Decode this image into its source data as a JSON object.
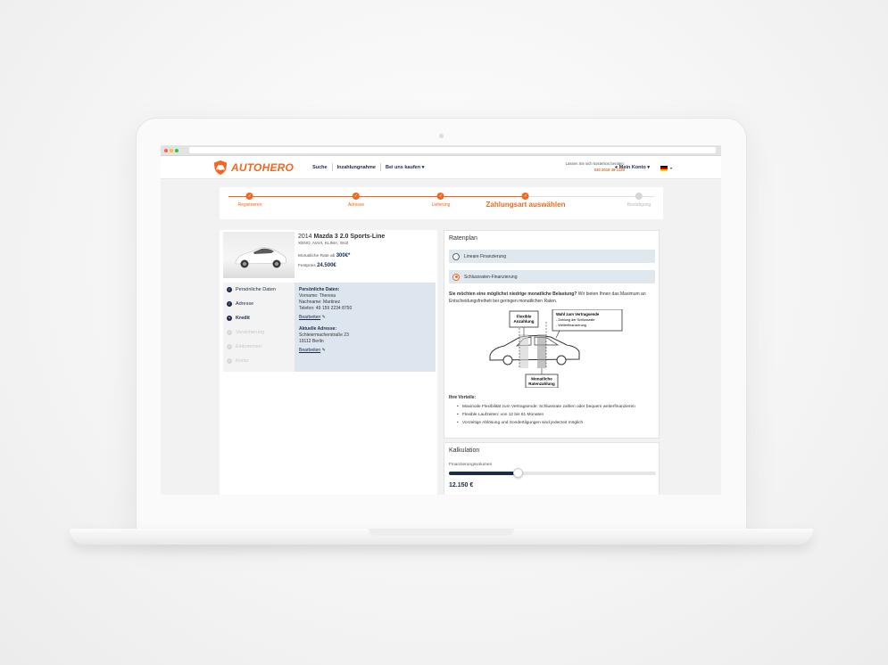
{
  "brand": {
    "name": "AUTOHERO",
    "accent": "#f26722",
    "navy": "#1a2b4c"
  },
  "nav": {
    "items": [
      "Suche",
      "Inzahlungnahme",
      "Bei uns kaufen ▾"
    ]
  },
  "advice": {
    "text": "Lassen Sie sich kostenlos beraten:",
    "phone": "030 2016 38 1120"
  },
  "account": {
    "label": "Mein Konto ▾"
  },
  "progress": {
    "steps": [
      {
        "label": "Registrieren",
        "state": "done"
      },
      {
        "label": "Adresse",
        "state": "done"
      },
      {
        "label": "Lieferung",
        "state": "done"
      },
      {
        "label": "Zahlungsart auswählen",
        "state": "active"
      },
      {
        "label": "Bestätigung",
        "state": "todo"
      }
    ],
    "check": "✓"
  },
  "car": {
    "year": "2014",
    "model": "Mazda 3 2.0 Sports-Line",
    "features": "XENO, NAVI, KLIMA, SHZ",
    "rate_label": "Monatliche Rate ab",
    "rate_value": "300€*",
    "price_label": "Festpreis",
    "price_value": "24.500€"
  },
  "sidenav": {
    "items": [
      {
        "label": "Persönliche Daten",
        "state": "done",
        "icon": "✓"
      },
      {
        "label": "Adresse",
        "state": "done",
        "icon": "✓"
      },
      {
        "label": "Kredit",
        "state": "current",
        "icon": "+"
      },
      {
        "label": "Versicherung",
        "state": "disabled",
        "icon": "+"
      },
      {
        "label": "Einkommen",
        "state": "disabled",
        "icon": "+"
      },
      {
        "label": "Konto",
        "state": "disabled",
        "icon": "+"
      }
    ]
  },
  "personal": {
    "heading": "Persönliche Daten:",
    "first": "Vorname: Theresa",
    "last": "Nachname: Martinez",
    "phone": "Telefon: 49 159 2234 8750",
    "edit": "Bearbeiten",
    "addr_heading": "Aktuelle Adresse:",
    "street": "Schleiermacherstraße 23",
    "city": "19112 Berlin",
    "edit2": "Bearbeiten"
  },
  "ratenplan": {
    "title": "Ratenplan",
    "options": [
      {
        "label": "Lineare Finanzierung",
        "selected": false
      },
      {
        "label": "Schlussraten-Finanzierung",
        "selected": true
      }
    ],
    "question_bold": "Sie möchten eine möglichst niedrige monatliche Belastung?",
    "question_rest": " Wir bieten Ihnen das Maximum an Entscheidungsfreiheit bei geringen monatlichen Raten.",
    "diagram": {
      "box1": [
        "Flexible",
        "Anzahlung"
      ],
      "box2_title": "Wahl zum Vertragsende",
      "box2_lines": [
        "- Zahlung der Schlussrate",
        "- Weiterfinanzierung"
      ],
      "box3": [
        "Monatliche",
        "Ratenzahlung"
      ]
    },
    "advantages_heading": "Ihre Vorteile:",
    "advantages": [
      "Maximale Flexibilität zum Vertragsende: Schlussrate zahlen oder bequem weiterfinanzieren",
      "Flexible Laufzeiten: von 12 bis 61 Monaten",
      "Vorzeitige Ablösung und Sondertilgungen sind jederzeit möglich"
    ]
  },
  "kalkulation": {
    "title": "Kalkulation",
    "label": "Finanzierungsvolumen",
    "amount": "12.150 €",
    "slider_fraction": 0.33
  }
}
